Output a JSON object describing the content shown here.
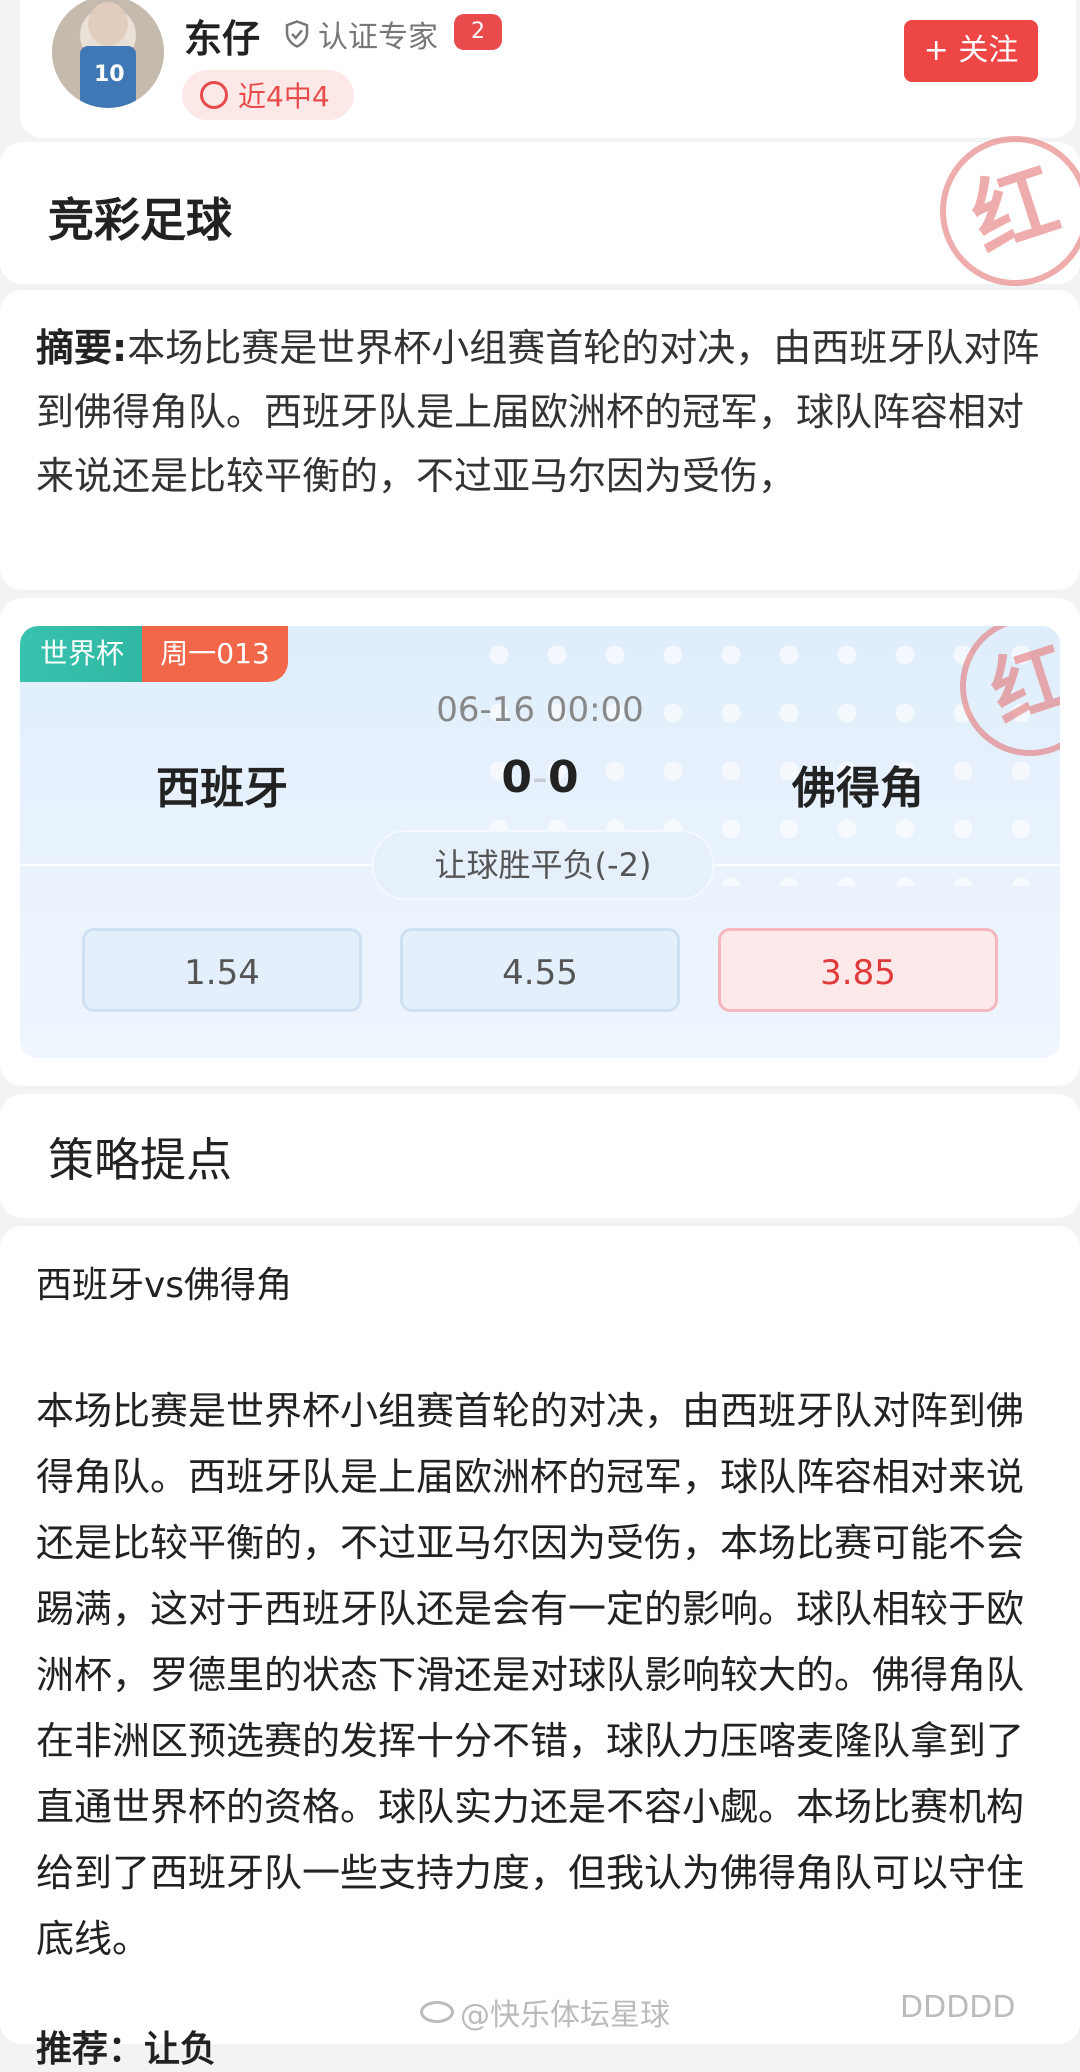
{
  "header": {
    "username": "东仔",
    "cert_label": "认证专家",
    "cert_count": "2",
    "streak": "近4中4",
    "follow_label": "+ 关注",
    "jersey_number": "10"
  },
  "section1": {
    "title": "竞彩足球",
    "stamp": "红"
  },
  "summary": {
    "label": "摘要:",
    "text": "本场比赛是世界杯小组赛首轮的对决，由西班牙队对阵到佛得角队。西班牙队是上届欧洲杯的冠军，球队阵容相对来说还是比较平衡的，不过亚马尔因为受伤，"
  },
  "match": {
    "league": "世界杯",
    "match_no": "周一013",
    "time": "06-16 00:00",
    "home": "西班牙",
    "away": "佛得角",
    "home_score": "0",
    "away_score": "0",
    "score_sep": "-",
    "market": "让球胜平负(-2)",
    "odds": [
      "1.54",
      "4.55",
      "3.85"
    ],
    "stamp": "红"
  },
  "strategy": {
    "title": "策略提点"
  },
  "body": {
    "subtitle": "西班牙vs佛得角",
    "text": "本场比赛是世界杯小组赛首轮的对决，由西班牙队对阵到佛得角队。西班牙队是上届欧洲杯的冠军，球队阵容相对来说还是比较平衡的，不过亚马尔因为受伤，本场比赛可能不会踢满，这对于西班牙队还是会有一定的影响。球队相较于欧洲杯，罗德里的状态下滑还是对球队影响较大的。佛得角队在非洲区预选赛的发挥十分不错，球队力压喀麦隆队拿到了直通世界杯的资格。球队实力还是不容小觑。本场比赛机构给到了西班牙队一些支持力度，但我认为佛得角队可以守住底线。",
    "recommend": "推荐：让负"
  },
  "watermark": {
    "text": "@快乐体坛星球",
    "right": "DDDDD"
  },
  "colors": {
    "accent_red": "#ee4545",
    "teal": "#2fb7a2",
    "orange": "#f2664a"
  }
}
